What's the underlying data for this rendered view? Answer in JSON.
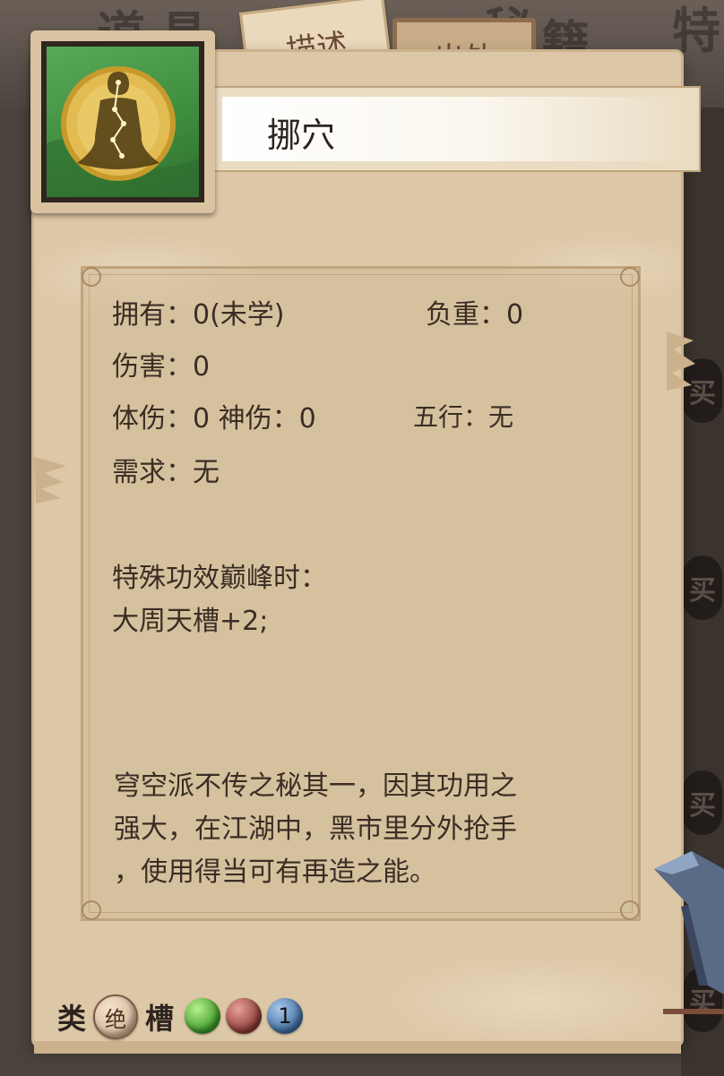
{
  "tabs": {
    "description": "描述",
    "source": "出处"
  },
  "item": {
    "name": "挪穴",
    "icon": "meditating-figure-icon"
  },
  "stats": {
    "owned_label": "拥有：",
    "owned_value": "0(未学)",
    "weight_label": "负重：",
    "weight_value": "0",
    "damage_label": "伤害：",
    "damage_value": "0",
    "body_damage_label": "体伤：",
    "body_damage_value": "0",
    "spirit_damage_label": "神伤：",
    "spirit_damage_value": "0",
    "element_label": "五行：",
    "element_value": "无",
    "requirement_label": "需求：",
    "requirement_value": "无"
  },
  "special": {
    "header": "特殊功效巅峰时：",
    "effect": "大周天槽+2;"
  },
  "description_lines": [
    "穹空派不传之秘其一，因其功用之",
    "强大，在江湖中，黑市里分外抢手",
    "，使用得当可有再造之能。"
  ],
  "bottom": {
    "category_label": "类",
    "category_value": "绝",
    "slot_label": "槽",
    "slot_count": "1",
    "orb_colors": [
      "#3d9a2a",
      "#8a3a36",
      "#3e6ea0"
    ]
  },
  "background_glyphs": [
    "道",
    "具",
    "秘",
    "籍",
    "特",
    "买"
  ]
}
